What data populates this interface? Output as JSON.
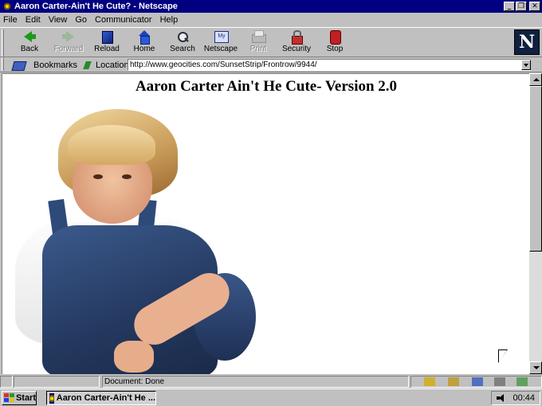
{
  "window": {
    "title": "Aaron Carter-Ain't He Cute? - Netscape",
    "buttons": [
      "minimize",
      "restore",
      "close"
    ]
  },
  "menu": [
    "File",
    "Edit",
    "View",
    "Go",
    "Communicator",
    "Help"
  ],
  "toolbar": {
    "buttons": [
      {
        "label": "Back",
        "icon": "back-arrow-icon",
        "enabled": true
      },
      {
        "label": "Forward",
        "icon": "forward-arrow-icon",
        "enabled": false
      },
      {
        "label": "Reload",
        "icon": "reload-icon",
        "enabled": true
      },
      {
        "label": "Home",
        "icon": "home-icon",
        "enabled": true
      },
      {
        "label": "Search",
        "icon": "search-icon",
        "enabled": true
      },
      {
        "label": "Netscape",
        "icon": "my-netscape-icon",
        "enabled": true
      },
      {
        "label": "Print",
        "icon": "print-icon",
        "enabled": false
      },
      {
        "label": "Security",
        "icon": "security-lock-icon",
        "enabled": true
      },
      {
        "label": "Stop",
        "icon": "stop-icon",
        "enabled": true
      }
    ],
    "logo": "N"
  },
  "location_bar": {
    "bookmarks_label": "Bookmarks",
    "location_label": "Location:",
    "url": "http://www.geocities.com/SunsetStrip/Frontrow/9944/"
  },
  "page": {
    "heading": "Aaron Carter Ain't He Cute- Version 2.0"
  },
  "status": {
    "text": "Document: Done"
  },
  "taskbar": {
    "start_label": "Start",
    "task_label": "Aaron Carter-Ain't He ...",
    "clock": "00:44"
  },
  "colors": {
    "title_bar": "#000080",
    "chrome": "#c0c0c0",
    "page_background": "#ffffff"
  }
}
